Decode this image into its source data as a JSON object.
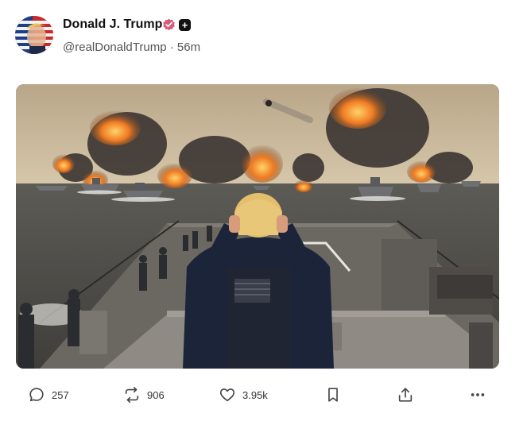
{
  "author": {
    "name": "Donald J. Trump",
    "handle": "@realDonaldTrump",
    "separator": "·",
    "time": "56m",
    "verified_icon": "verified-badge-icon",
    "extra_badge_icon": "plus-badge-icon",
    "verified_color": "#d9587b"
  },
  "media": {
    "kind": "photo"
  },
  "actions": {
    "replies": "257",
    "reposts": "906",
    "likes": "3.95k",
    "icons": [
      "comment-icon",
      "repost-icon",
      "heart-icon",
      "bookmark-icon",
      "share-icon",
      "more-icon"
    ]
  }
}
